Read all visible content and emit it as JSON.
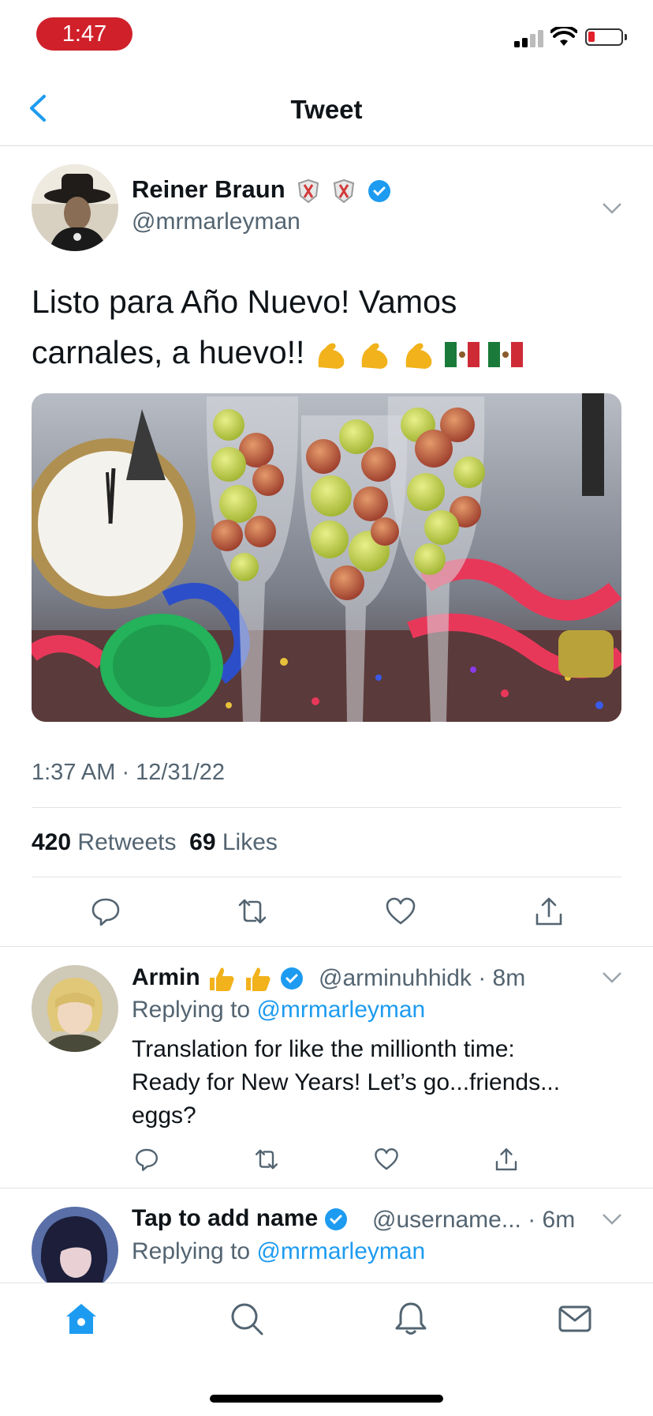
{
  "status_bar": {
    "time": "1:47"
  },
  "nav": {
    "title": "Tweet"
  },
  "tweet": {
    "author_name": "Reiner Braun",
    "author_handle": "@mrmarleyman",
    "text_line1": "Listo para Año Nuevo! Vamos",
    "text_line2": "carnales, a huevo!!",
    "timestamp": "1:37 AM · 12/31/22",
    "retweets_count": "420",
    "retweets_label": "Retweets",
    "likes_count": "69",
    "likes_label": "Likes"
  },
  "replies": [
    {
      "name": "Armin",
      "handle": "@arminuhhidk",
      "time": "8m",
      "replying_prefix": "Replying to",
      "replying_to": "@mrmarleyman",
      "text_line1": "Translation for like the millionth time:",
      "text_line2": "Ready for New Years! Let’s go...friends...",
      "text_line3": "eggs?"
    },
    {
      "name": "Tap to add name",
      "handle": "@username...",
      "time": "6m",
      "replying_prefix": "Replying to",
      "replying_to": "@mrmarleyman"
    }
  ],
  "tabs": [
    "home-icon",
    "search-icon",
    "notifications-icon",
    "messages-icon"
  ],
  "colors": {
    "accent": "#1d9bf0",
    "time_pill": "#d0202a",
    "secondary_text": "#536471"
  }
}
